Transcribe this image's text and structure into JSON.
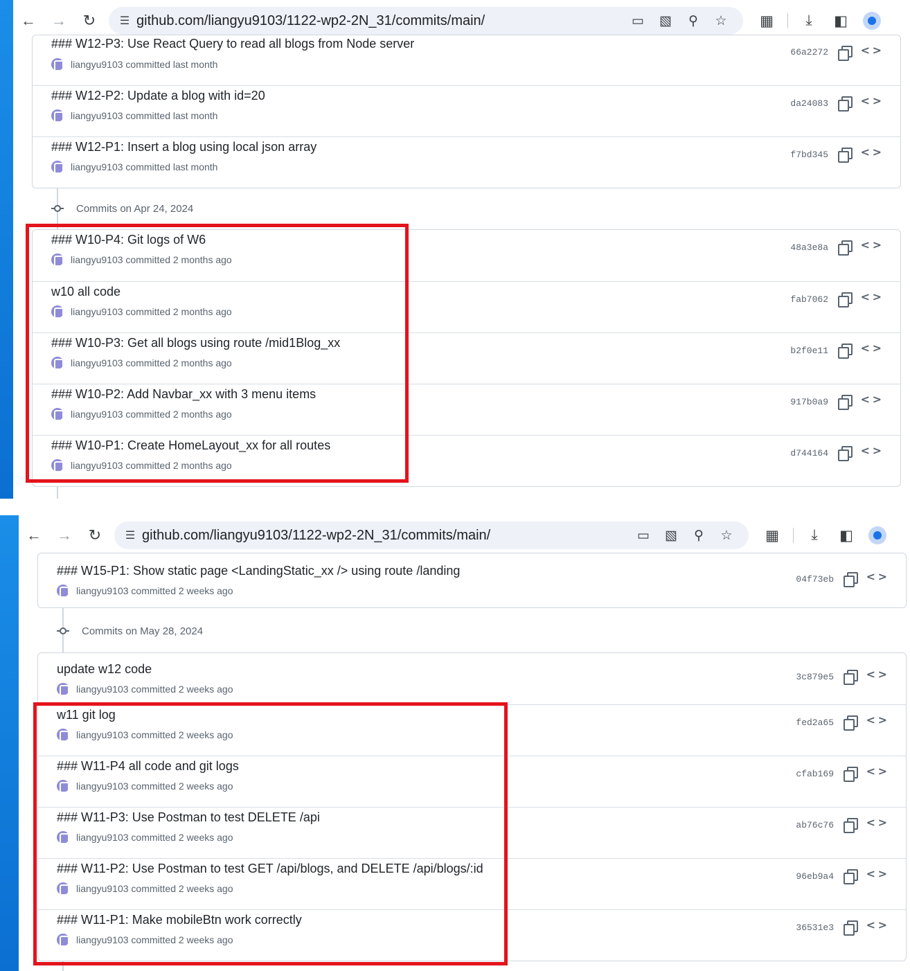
{
  "screens": [
    {
      "url": "github.com/liangyu9103/1122-wp2-2N_31/commits/main/",
      "group_top": {
        "commits": [
          {
            "title": "### W12-P3: Use React Query to read all blogs from Node server",
            "author": "liangyu9103",
            "when": "committed last month",
            "sha": "66a2272"
          },
          {
            "title": "### W12-P2: Update a blog with id=20",
            "author": "liangyu9103",
            "when": "committed last month",
            "sha": "da24083"
          },
          {
            "title": "### W12-P1: Insert a blog using local json array",
            "author": "liangyu9103",
            "when": "committed last month",
            "sha": "f7bd345"
          }
        ]
      },
      "group_header": "Commits on Apr 24, 2024",
      "group_bottom": {
        "commits": [
          {
            "title": "### W10-P4: Git logs of W6",
            "author": "liangyu9103",
            "when": "committed 2 months ago",
            "sha": "48a3e8a"
          },
          {
            "title": "w10 all code",
            "author": "liangyu9103",
            "when": "committed 2 months ago",
            "sha": "fab7062"
          },
          {
            "title": "### W10-P3: Get all blogs using route /mid1Blog_xx",
            "author": "liangyu9103",
            "when": "committed 2 months ago",
            "sha": "b2f0e11"
          },
          {
            "title": "### W10-P2: Add Navbar_xx with 3 menu items",
            "author": "liangyu9103",
            "when": "committed 2 months ago",
            "sha": "917b0a9"
          },
          {
            "title": "### W10-P1: Create HomeLayout_xx for all routes",
            "author": "liangyu9103",
            "when": "committed 2 months ago",
            "sha": "d744164"
          }
        ]
      }
    },
    {
      "url": "github.com/liangyu9103/1122-wp2-2N_31/commits/main/",
      "group_top": {
        "commits": [
          {
            "title": "### W15-P1: Show static page <LandingStatic_xx /> using route /landing",
            "author": "liangyu9103",
            "when": "committed 2 weeks ago",
            "sha": "04f73eb"
          }
        ]
      },
      "group_header": "Commits on May 28, 2024",
      "group_bottom": {
        "commits": [
          {
            "title": "update w12 code",
            "author": "liangyu9103",
            "when": "committed 2 weeks ago",
            "sha": "3c879e5"
          },
          {
            "title": "w11 git log",
            "author": "liangyu9103",
            "when": "committed 2 weeks ago",
            "sha": "fed2a65"
          },
          {
            "title": "### W11-P4 all code and git logs",
            "author": "liangyu9103",
            "when": "committed 2 weeks ago",
            "sha": "cfab169"
          },
          {
            "title": "### W11-P3: Use Postman to test DELETE /api",
            "author": "liangyu9103",
            "when": "committed 2 weeks ago",
            "sha": "ab76c76"
          },
          {
            "title": "### W11-P2: Use Postman to test GET /api/blogs, and DELETE /api/blogs/:id",
            "author": "liangyu9103",
            "when": "committed 2 weeks ago",
            "sha": "96eb9a4"
          },
          {
            "title": "### W11-P1: Make mobileBtn work correctly",
            "author": "liangyu9103",
            "when": "committed 2 weeks ago",
            "sha": "36531e3"
          }
        ]
      }
    }
  ],
  "icons": {
    "back": "arrow-left-icon",
    "forward": "arrow-right-icon",
    "reload": "reload-icon",
    "site_info": "tune-icon",
    "install": "install-app-icon",
    "translate": "translate-icon",
    "zoom": "zoom-icon",
    "bookmark": "star-icon",
    "extensions": "puzzle-icon",
    "downloads": "download-icon",
    "side_panel": "side-panel-icon",
    "profile": "profile-icon",
    "copy": "copy-icon",
    "browse": "code-brackets-icon",
    "avatar": "user-avatar-icon"
  },
  "colors": {
    "highlight": "#e3141d",
    "desktop": "#1a8ee8",
    "accent": "#1a73e8"
  }
}
